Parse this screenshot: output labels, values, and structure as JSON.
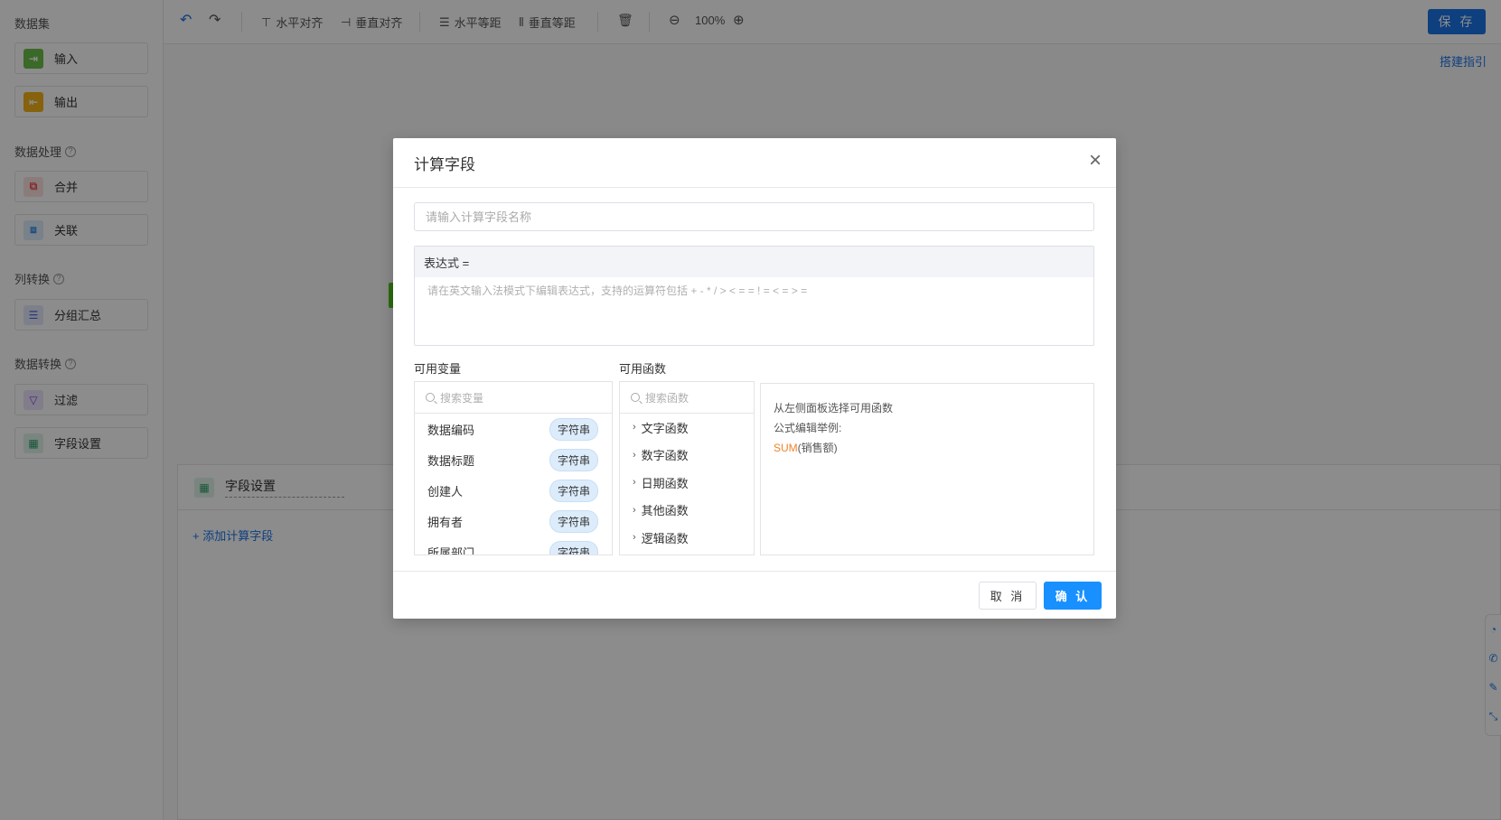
{
  "sidebar": {
    "groups": {
      "dataset": "数据集",
      "processing": "数据处理",
      "column": "列转换",
      "transform": "数据转换"
    },
    "nodes": {
      "input": "输入",
      "output": "输出",
      "merge": "合并",
      "join": "关联",
      "group": "分组汇总",
      "filter": "过滤",
      "field": "字段设置"
    },
    "help_glyph": "?"
  },
  "toolbar": {
    "h_align": "水平对齐",
    "v_align": "垂直对齐",
    "h_space": "水平等距",
    "v_space": "垂直等距",
    "zoom": "100%",
    "save": "保 存",
    "guide": "搭建指引"
  },
  "bottom_panel": {
    "title": "字段设置",
    "add": "+ 添加计算字段"
  },
  "modal": {
    "title": "计算字段",
    "name_placeholder": "请输入计算字段名称",
    "expr_label": "表达式 =",
    "expr_placeholder": "请在英文输入法模式下编辑表达式，支持的运算符包括 + - * / > < = = ! = < = > =",
    "var_label": "可用变量",
    "var_search": "搜索变量",
    "variables": [
      {
        "name": "数据编码",
        "type": "字符串"
      },
      {
        "name": "数据标题",
        "type": "字符串"
      },
      {
        "name": "创建人",
        "type": "字符串"
      },
      {
        "name": "拥有者",
        "type": "字符串"
      },
      {
        "name": "所属部门",
        "type": "字符串"
      }
    ],
    "fn_label": "可用函数",
    "fn_search": "搜索函数",
    "functions": [
      "文字函数",
      "数字函数",
      "日期函数",
      "其他函数",
      "逻辑函数"
    ],
    "info": {
      "line1": "从左侧面板选择可用函数",
      "line2": "公式编辑举例:",
      "example_fn": "SUM",
      "example_arg": "(销售额)"
    },
    "cancel": "取 消",
    "confirm": "确 认"
  },
  "colors": {
    "primary": "#1890ff",
    "save": "#1a73e8",
    "tag_bg": "#dcecfb",
    "example_fn": "#f0832a"
  }
}
